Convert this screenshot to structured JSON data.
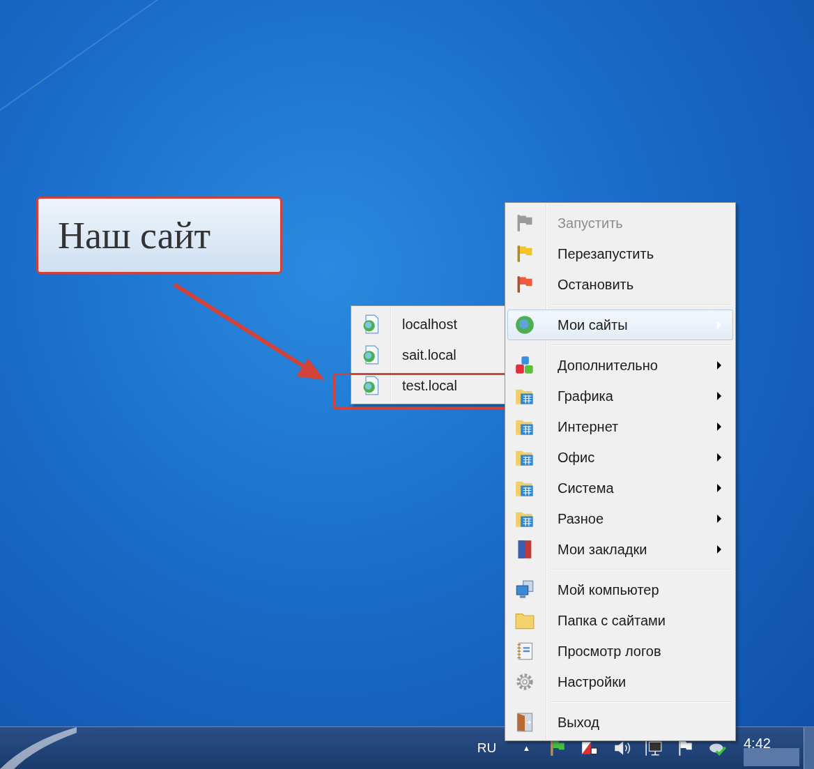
{
  "callout": {
    "text": "Наш сайт"
  },
  "submenu": {
    "items": [
      {
        "label": "localhost",
        "kind": "site",
        "annotated": false
      },
      {
        "label": "sait.local",
        "kind": "site",
        "annotated": false
      },
      {
        "label": "test.local",
        "kind": "site",
        "annotated": true
      }
    ]
  },
  "menu": {
    "groups": [
      [
        {
          "label": "Запустить",
          "kind": "start",
          "disabled": true,
          "selected": false,
          "has_submenu": false
        },
        {
          "label": "Перезапустить",
          "kind": "restart",
          "disabled": false,
          "selected": false,
          "has_submenu": false
        },
        {
          "label": "Остановить",
          "kind": "stop",
          "disabled": false,
          "selected": false,
          "has_submenu": false
        }
      ],
      [
        {
          "label": "Мои сайты",
          "kind": "sites",
          "disabled": false,
          "selected": true,
          "has_submenu": true
        }
      ],
      [
        {
          "label": "Дополнительно",
          "kind": "extra",
          "disabled": false,
          "selected": false,
          "has_submenu": true
        },
        {
          "label": "Графика",
          "kind": "program-folder",
          "disabled": false,
          "selected": false,
          "has_submenu": true
        },
        {
          "label": "Интернет",
          "kind": "program-folder",
          "disabled": false,
          "selected": false,
          "has_submenu": true
        },
        {
          "label": "Офис",
          "kind": "program-folder",
          "disabled": false,
          "selected": false,
          "has_submenu": true
        },
        {
          "label": "Система",
          "kind": "program-folder",
          "disabled": false,
          "selected": false,
          "has_submenu": true
        },
        {
          "label": "Разное",
          "kind": "program-folder",
          "disabled": false,
          "selected": false,
          "has_submenu": true
        },
        {
          "label": "Мои закладки",
          "kind": "bookmarks",
          "disabled": false,
          "selected": false,
          "has_submenu": true
        }
      ],
      [
        {
          "label": "Мой компьютер",
          "kind": "computer",
          "disabled": false,
          "selected": false,
          "has_submenu": false
        },
        {
          "label": "Папка с сайтами",
          "kind": "folder",
          "disabled": false,
          "selected": false,
          "has_submenu": false
        },
        {
          "label": "Просмотр логов",
          "kind": "logs",
          "disabled": false,
          "selected": false,
          "has_submenu": false
        },
        {
          "label": "Настройки",
          "kind": "settings",
          "disabled": false,
          "selected": false,
          "has_submenu": false
        }
      ],
      [
        {
          "label": "Выход",
          "kind": "exit",
          "disabled": false,
          "selected": false,
          "has_submenu": false
        }
      ]
    ]
  },
  "taskbar": {
    "language": "RU",
    "tray_arrow": "▲",
    "clock": "4:42"
  }
}
